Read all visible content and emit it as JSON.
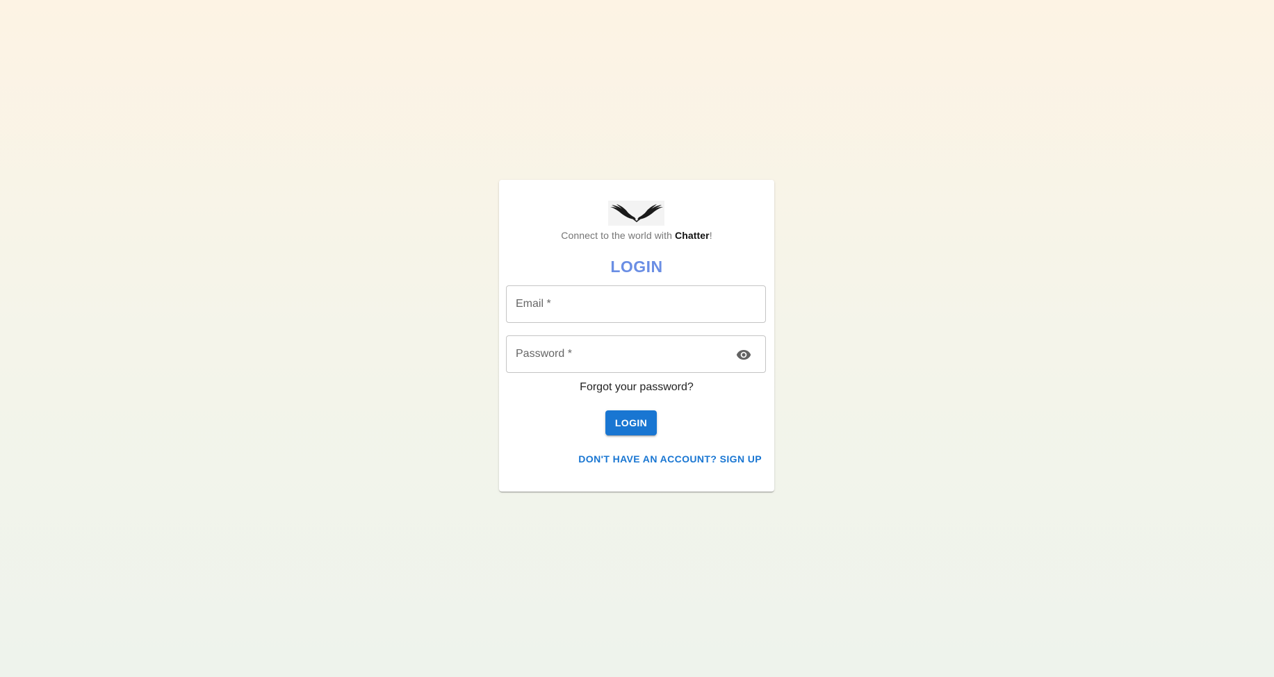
{
  "brand": {
    "logo_icon": "wings-icon",
    "tagline_prefix": "Connect to the world with ",
    "tagline_name": "Chatter",
    "tagline_suffix": "!"
  },
  "form": {
    "title": "LOGIN",
    "email_label": "Email *",
    "password_label": "Password *",
    "password_toggle_icon": "eye-icon",
    "forgot_link": "Forgot your password?",
    "submit_label": "LOGIN",
    "signup_link": "DON'T HAVE AN ACCOUNT? SIGN UP"
  },
  "colors": {
    "title": "#6a8ee4",
    "primary": "#1976d2"
  }
}
